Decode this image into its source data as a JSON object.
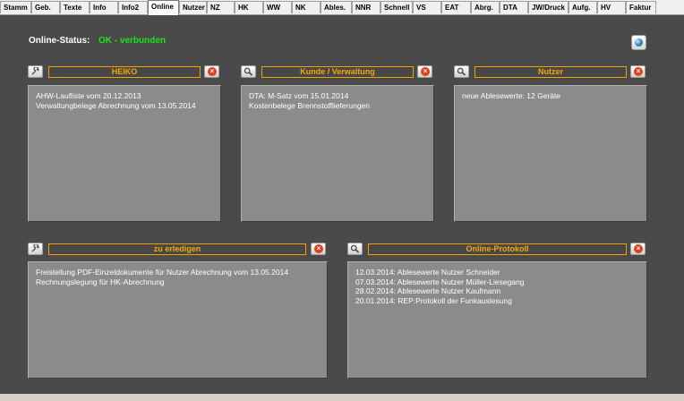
{
  "tabs": [
    "Stamm",
    "Geb.",
    "Texte",
    "Info",
    "Info2",
    "Online",
    "Nutzer",
    "NZ",
    "HK",
    "WW",
    "NK",
    "Ables.",
    "NNR",
    "Schnell",
    "VS",
    "EAT",
    "Abrg.",
    "DTA",
    "JW/Druck",
    "Aufg.",
    "HV",
    "Faktur"
  ],
  "active_tab": "Online",
  "status": {
    "label": "Online-Status:",
    "value": "OK - verbunden",
    "value_color": "#19e619"
  },
  "panels": {
    "heiko": {
      "title": "HEIKO",
      "lines": [
        "AHW-Laufliste vom 20.12.2013",
        "Verwaltungbelege Abrechnung  vom 13.05.2014"
      ]
    },
    "kunde": {
      "title": "Kunde / Verwaltung",
      "lines": [
        "DTA: M-Satz vom 15.01.2014",
        "Kostenbelege Brennstofflieferungen"
      ]
    },
    "nutzer": {
      "title": "Nutzer",
      "lines": [
        "neue Ablesewerte: 12 Geräte"
      ]
    },
    "zu_erledigen": {
      "title": "zu erledigen",
      "lines": [
        "Freistellung PDF-Einzeldokumente für Nutzer Abrechnung  vom 13.05.2014",
        "Rechnungslegung für HK-Abrechnung"
      ]
    },
    "protokoll": {
      "title": "Online-Protokoll",
      "lines": [
        "12.03.2014: Ablesewerte Nutzer Schneider",
        "07.03.2014: Ablesewerte Nutzer Müller-Liesegang",
        "28.02.2014: Ablesewerte Nutzer Kaufmann",
        "20.01.2014: REP:Protokoll der  Funkauslesung"
      ]
    }
  },
  "colors": {
    "background": "#4a4a4a",
    "panel": "#8b8b8b",
    "accent": "#f7a800",
    "close": "#e0401a"
  },
  "icons": {
    "globe": "globe-icon",
    "wrench": "wrench-icon",
    "search": "search-icon",
    "close": "close-icon"
  }
}
